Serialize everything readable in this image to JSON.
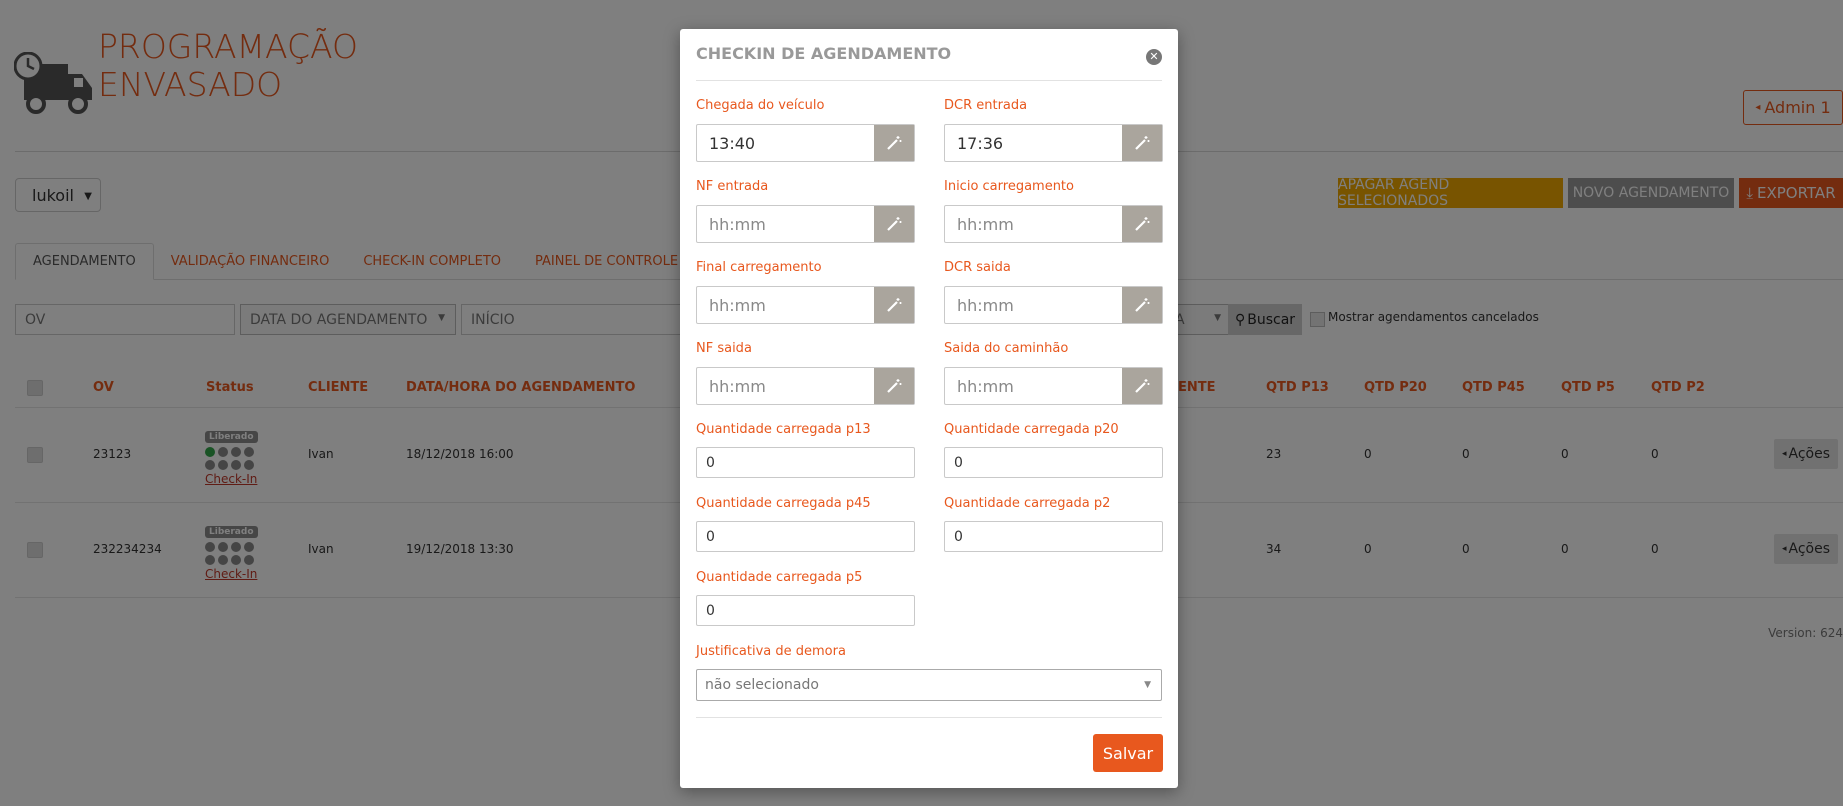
{
  "logo": {
    "line1": "PROGRAMAÇÃO",
    "line2": "ENVASADO"
  },
  "header": {
    "admin_label": "Admin 1"
  },
  "client_select": {
    "value": "lukoil"
  },
  "actions": {
    "apagar_label": "APAGAR AGEND SELECIONADOS",
    "novo_label": "NOVO AGENDAMENTO",
    "exportar_label": "EXPORTAR"
  },
  "tabs": [
    {
      "label": "AGENDAMENTO"
    },
    {
      "label": "VALIDAÇÃO FINANCEIRO"
    },
    {
      "label": "CHECK-IN COMPLETO"
    },
    {
      "label": "PAINEL DE CONTROLE"
    }
  ],
  "filters": {
    "ov_placeholder": "OV",
    "data_placeholder": "DATA DO AGENDAMENTO",
    "inicio_placeholder": "INÍCIO",
    "other_value": "A",
    "buscar_label": "Buscar",
    "cancelados_label": "Mostrar agendamentos cancelados"
  },
  "table": {
    "headers": {
      "ov": "OV",
      "status": "Status",
      "cliente": "CLIENTE",
      "data_hora": "DATA/HORA DO AGENDAMENTO",
      "partial": "ENTE",
      "p13": "QTD P13",
      "p20": "QTD P20",
      "p45": "QTD P45",
      "p5": "QTD P5",
      "p2": "QTD P2"
    },
    "rows": [
      {
        "ov": "23123",
        "badge": "Liberado",
        "checkin": "Check-In",
        "cliente": "Ivan",
        "data_hora": "18/12/2018 16:00",
        "p13": "23",
        "p20": "0",
        "p45": "0",
        "p5": "0",
        "p2": "0",
        "acoes": "Ações"
      },
      {
        "ov": "232234234",
        "badge": "Liberado",
        "checkin": "Check-In",
        "cliente": "Ivan",
        "data_hora": "19/12/2018 13:30",
        "p13": "34",
        "p20": "0",
        "p45": "0",
        "p5": "0",
        "p2": "0",
        "acoes": "Ações"
      }
    ]
  },
  "version": "Version: 624",
  "modal": {
    "title": "CHECKIN DE AGENDAMENTO",
    "fields": {
      "chegada": {
        "label": "Chegada do veículo",
        "value": "13:40"
      },
      "dcr_entrada": {
        "label": "DCR entrada",
        "value": "17:36"
      },
      "nf_entrada": {
        "label": "NF entrada",
        "placeholder": "hh:mm"
      },
      "inicio_carregamento": {
        "label": "Inicio carregamento",
        "placeholder": "hh:mm"
      },
      "final_carregamento": {
        "label": "Final carregamento",
        "placeholder": "hh:mm"
      },
      "dcr_saida": {
        "label": "DCR saida",
        "placeholder": "hh:mm"
      },
      "nf_saida": {
        "label": "NF saida",
        "placeholder": "hh:mm"
      },
      "saida_caminhao": {
        "label": "Saida do caminhão",
        "placeholder": "hh:mm"
      }
    },
    "quantities": {
      "p13": {
        "label": "Quantidade carregada p13",
        "value": "0"
      },
      "p20": {
        "label": "Quantidade carregada p20",
        "value": "0"
      },
      "p45": {
        "label": "Quantidade carregada p45",
        "value": "0"
      },
      "p2": {
        "label": "Quantidade carregada p2",
        "value": "0"
      },
      "p5": {
        "label": "Quantidade carregada p5",
        "value": "0"
      }
    },
    "justificativa": {
      "label": "Justificativa de demora",
      "value": "não selecionado"
    },
    "salvar_label": "Salvar"
  },
  "colors": {
    "accent": "#e8581e",
    "warning": "#f0a800",
    "neutral_button": "#9b9b9b",
    "status_green": "#33a64b"
  }
}
